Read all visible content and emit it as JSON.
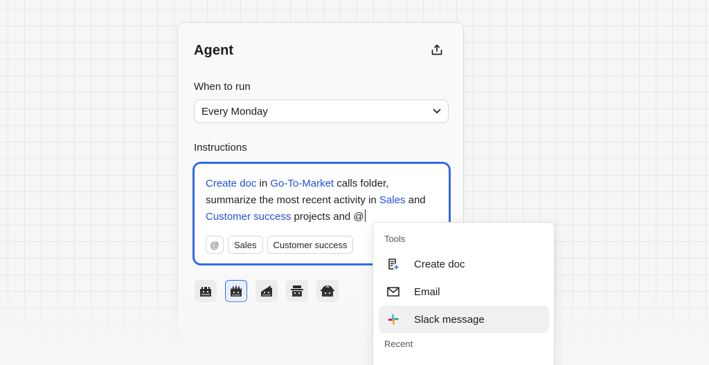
{
  "panel": {
    "title": "Agent",
    "share_icon": "share-icon"
  },
  "schedule": {
    "label": "When to run",
    "value": "Every Monday",
    "icon": "chevron-down-icon"
  },
  "instructions": {
    "label": "Instructions",
    "parts": {
      "p1": "Create doc",
      "p2": " in ",
      "p3": "Go-To-Market",
      "p4": " calls folder, summarize the most recent activity in ",
      "p5": "Sales",
      "p6": " and ",
      "p7": "Customer success",
      "p8": " projects and @"
    },
    "chips": {
      "at": "@",
      "sales": "Sales",
      "customer_success": "Customer success"
    }
  },
  "models": [
    {
      "icon": "crown-face-icon",
      "selected": false
    },
    {
      "icon": "spiky-face-icon",
      "selected": true
    },
    {
      "icon": "wing-face-icon",
      "selected": false
    },
    {
      "icon": "hat-face-icon",
      "selected": false
    },
    {
      "icon": "dome-face-icon",
      "selected": false
    }
  ],
  "dropdown": {
    "tools_heading": "Tools",
    "items": [
      {
        "label": "Create doc",
        "icon": "create-doc-icon"
      },
      {
        "label": "Email",
        "icon": "email-icon"
      },
      {
        "label": "Slack message",
        "icon": "slack-icon",
        "highlighted": true
      }
    ],
    "recent_heading": "Recent"
  },
  "colors": {
    "accent": "#2f6bf0",
    "link": "#1f52dc",
    "slack_blue": "#36c5f0",
    "slack_green": "#2eb67d",
    "slack_yellow": "#ecb22e",
    "slack_red": "#e01e5a"
  }
}
